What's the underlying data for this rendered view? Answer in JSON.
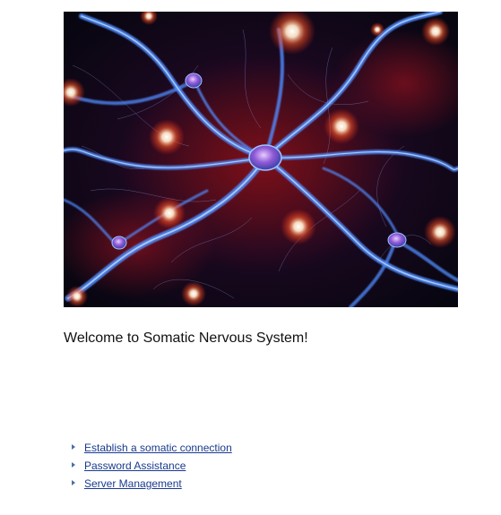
{
  "hero": {
    "image_icon": "neural-network-image"
  },
  "welcome": {
    "text": "Welcome to Somatic Nervous System!"
  },
  "links": [
    {
      "label": "Establish a somatic connection",
      "icon": "triangle-bullet-icon"
    },
    {
      "label": "Password Assistance",
      "icon": "triangle-bullet-icon"
    },
    {
      "label": "Server Management",
      "icon": "triangle-bullet-icon"
    }
  ],
  "colors": {
    "link": "#1a3a8f",
    "bullet": "#4a6fa1",
    "text": "#111111",
    "background": "#ffffff"
  }
}
